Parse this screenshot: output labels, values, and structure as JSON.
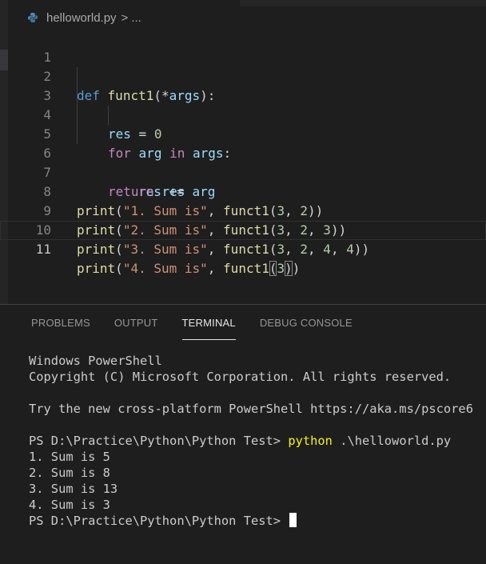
{
  "breadcrumb": {
    "file": "helloworld.py",
    "separator": ">",
    "more": "..."
  },
  "editor": {
    "line_numbers": [
      "1",
      "2",
      "3",
      "4",
      "5",
      "6",
      "7",
      "8",
      "9",
      "10",
      "11"
    ],
    "lines": {
      "l2": {
        "kw": "def",
        "fn": "funct1",
        "open": "(*",
        "param": "args",
        "close": "):"
      },
      "l3": {
        "var": "res",
        "op": " = ",
        "num": "0"
      },
      "l4": {
        "kw": "for",
        "var1": "arg",
        "kw2": "in",
        "var2": "args",
        "colon": ":"
      },
      "l5": {
        "var1": "res",
        "op": " += ",
        "var2": "arg"
      },
      "l6": {
        "kw": "return",
        "var": "res"
      },
      "l8": {
        "fn1": "print",
        "p1": "(",
        "str": "\"1. Sum is\"",
        "p2": ", ",
        "fn2": "funct1",
        "p3": "(",
        "n1": "3",
        "c1": ", ",
        "n2": "2",
        "p4": "))"
      },
      "l9": {
        "fn1": "print",
        "p1": "(",
        "str": "\"2. Sum is\"",
        "p2": ", ",
        "fn2": "funct1",
        "p3": "(",
        "n1": "3",
        "c1": ", ",
        "n2": "2",
        "c2": ", ",
        "n3": "3",
        "p4": "))"
      },
      "l10": {
        "fn1": "print",
        "p1": "(",
        "str": "\"3. Sum is\"",
        "p2": ", ",
        "fn2": "funct1",
        "p3": "(",
        "n1": "3",
        "c1": ", ",
        "n2": "2",
        "c2": ", ",
        "n3": "4",
        "c3": ", ",
        "n4": "4",
        "p4": "))"
      },
      "l11": {
        "fn1": "print",
        "p1": "(",
        "str": "\"4. Sum is\"",
        "p2": ", ",
        "fn2": "funct1",
        "p3": "(",
        "n1": "3",
        "p4": ")",
        "p5": ")"
      }
    }
  },
  "panel": {
    "tabs": [
      "PROBLEMS",
      "OUTPUT",
      "TERMINAL",
      "DEBUG CONSOLE"
    ],
    "active_tab": "TERMINAL"
  },
  "terminal": {
    "line1": "Windows PowerShell",
    "line2": "Copyright (C) Microsoft Corporation. All rights reserved.",
    "line3": "Try the new cross-platform PowerShell https://aka.ms/pscore6",
    "prompt1": "PS D:\\Practice\\Python\\Python Test> ",
    "cmd1": "python",
    "cmd1_args": " .\\helloworld.py",
    "out1": "1. Sum is 5",
    "out2": "2. Sum is 8",
    "out3": "3. Sum is 13",
    "out4": "4. Sum is 3",
    "prompt2": "PS D:\\Practice\\Python\\Python Test> "
  },
  "colors": {
    "background": "#1e1e1e",
    "keyword": "#569cd6",
    "control": "#c586c0",
    "function": "#dcdcaa",
    "variable": "#9cdcfe",
    "string": "#ce9178",
    "number": "#b5cea8",
    "terminal_command": "#f3f315"
  },
  "icons": {
    "file_icon": "python-file-icon"
  }
}
